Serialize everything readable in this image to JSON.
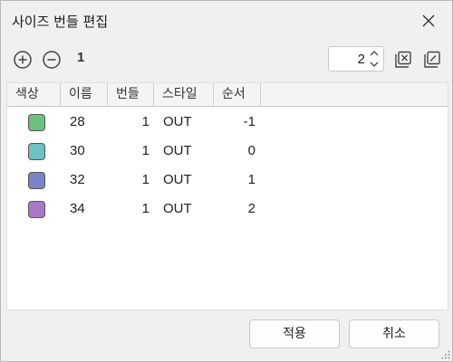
{
  "dialog": {
    "title": "사이즈 번들 편집"
  },
  "toolbar": {
    "count": "1",
    "spinner_value": "2"
  },
  "table": {
    "headers": [
      "색상",
      "이름",
      "번들",
      "스타일",
      "순서"
    ],
    "rows": [
      {
        "color": "#6dbf7c",
        "name": "28",
        "bundle": "1",
        "style": "OUT",
        "order": "-1"
      },
      {
        "color": "#6fc0c0",
        "name": "30",
        "bundle": "1",
        "style": "OUT",
        "order": "0"
      },
      {
        "color": "#7884c4",
        "name": "32",
        "bundle": "1",
        "style": "OUT",
        "order": "1"
      },
      {
        "color": "#a878c4",
        "name": "34",
        "bundle": "1",
        "style": "OUT",
        "order": "2"
      }
    ]
  },
  "buttons": {
    "apply": "적용",
    "cancel": "취소"
  },
  "icons": {
    "add": "plus-circle-icon",
    "remove": "minus-circle-icon",
    "clear": "clear-icon",
    "edit": "edit-icon",
    "close": "close-icon"
  }
}
